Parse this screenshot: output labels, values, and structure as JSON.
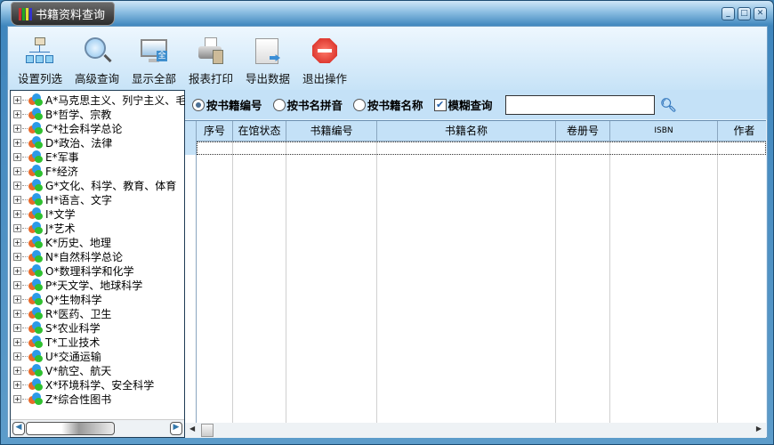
{
  "window": {
    "title": "书籍资料查询",
    "minimize": "minimize",
    "maximize": "maximize",
    "close": "close"
  },
  "toolbar": [
    {
      "label": "设置列选",
      "icon": "column-settings-icon"
    },
    {
      "label": "高级查询",
      "icon": "magnifier-icon"
    },
    {
      "label": "显示全部",
      "icon": "monitor-icon"
    },
    {
      "label": "报表打印",
      "icon": "printer-icon"
    },
    {
      "label": "导出数据",
      "icon": "export-icon"
    },
    {
      "label": "退出操作",
      "icon": "stop-icon"
    }
  ],
  "tree": [
    "A*马克思主义、列宁主义、毛",
    "B*哲学、宗教",
    "C*社会科学总论",
    "D*政治、法律",
    "E*军事",
    "F*经济",
    "G*文化、科学、教育、体育",
    "H*语言、文字",
    "I*文学",
    "J*艺术",
    "K*历史、地理",
    "N*自然科学总论",
    "O*数理科学和化学",
    "P*天文学、地球科学",
    "Q*生物科学",
    "R*医药、卫生",
    "S*农业科学",
    "T*工业技术",
    "U*交通运输",
    "V*航空、航天",
    "X*环境科学、安全科学",
    "Z*综合性图书"
  ],
  "search": {
    "options": [
      "按书籍编号",
      "按书名拼音",
      "按书籍名称"
    ],
    "selected": 0,
    "fuzzy_label": "模糊查询",
    "fuzzy_checked": true,
    "value": ""
  },
  "grid": {
    "columns": [
      "序号",
      "在馆状态",
      "书籍编号",
      "书籍名称",
      "卷册号",
      "ISBN",
      "作者"
    ]
  }
}
